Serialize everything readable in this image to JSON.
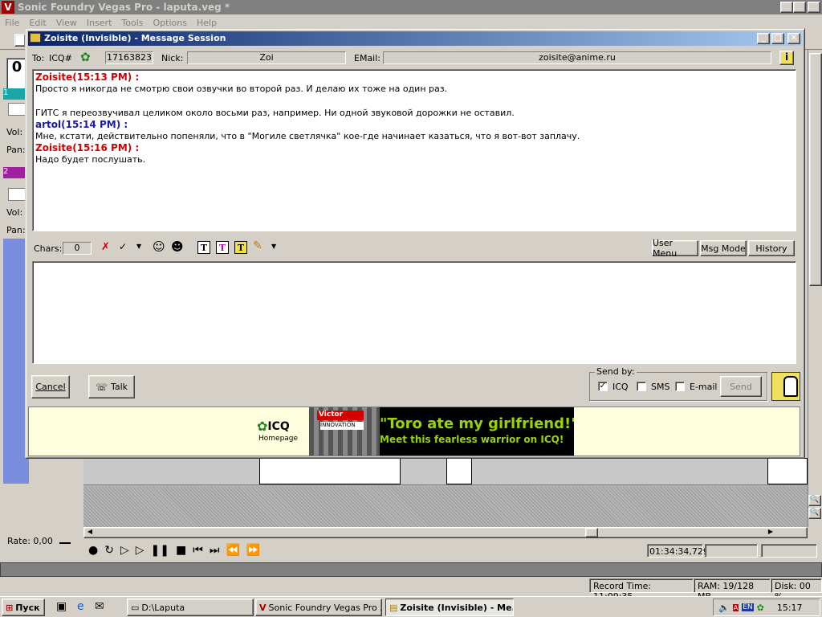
{
  "vegas": {
    "title": "Sonic Foundry Vegas Pro - laputa.veg *",
    "menu": [
      "File",
      "Edit",
      "View",
      "Insert",
      "Tools",
      "Options",
      "Help"
    ],
    "track_labels": {
      "vol1": "Vol:",
      "pan1": "Pan:",
      "vol2": "Vol:",
      "pan2": "Pan:",
      "num1": "1",
      "num2": "2"
    },
    "rate_label": "Rate: 0,00",
    "timecode": "01:34:34,729",
    "status": {
      "record": "Record Time: 11:09:35",
      "ram": "RAM: 19/128 MB",
      "disk": "Disk: 00 %"
    }
  },
  "icq": {
    "title": "Zoisite (Invisible) - Message Session",
    "header": {
      "to_label": "To:",
      "icq_label": "ICQ#",
      "uin": "17163823",
      "nick_label": "Nick:",
      "nick": "Zoi",
      "email_label": "EMail:",
      "email": "zoisite@anime.ru"
    },
    "messages": [
      {
        "head": "Zoisite(15:13 PM) :",
        "who": "zoi",
        "lines": [
          "Просто я никогда не смотрю свои озвучки во второй раз. И делаю их тоже на один раз.",
          "",
          "ГИТС я переозвучивал целиком около восьми раз, например. Ни одной звуковой дорожки не оставил."
        ]
      },
      {
        "head": "artol(15:14 PM) :",
        "who": "art",
        "lines": [
          "Мне, кстати, действительно попеняли, что в \"Могиле светлячка\" кое-где начинает казаться, что я вот-вот заплачу."
        ]
      },
      {
        "head": "Zoisite(15:16 PM) :",
        "who": "zoi",
        "lines": [
          "Надо будет послушать."
        ]
      }
    ],
    "toolbar": {
      "chars_label": "Chars:",
      "chars_value": "0",
      "user_menu": "User Menu",
      "msg_mode": "Msg Mode",
      "history": "History",
      "fmt_t": "T"
    },
    "input_value": "",
    "buttons": {
      "cancel": "Cancel",
      "talk": "Talk",
      "send": "Send"
    },
    "send_by": {
      "label": "Send by:",
      "icq": "ICQ",
      "sms": "SMS",
      "email": "E-mail",
      "icq_checked": true
    },
    "ad": {
      "logo": "ICQ",
      "homepage": "Homepage",
      "headline": "\"Toro ate my girlfriend!\"",
      "subline": "Meet this fearless warrior on ICQ!",
      "brand": "Victor",
      "brand2": "INNOVATION"
    }
  },
  "taskbar": {
    "start": "Пуск",
    "tasks": [
      "D:\\Laputa",
      "Sonic Foundry Vegas Pro ...",
      "Zoisite (Invisible) - Me..."
    ],
    "lang": "EN",
    "clock": "15:17"
  },
  "colors": {
    "icq_accent": "#d40000",
    "artol": "#1a1aaa",
    "ad_green": "#9ad400",
    "title_blue": "#0a246a"
  }
}
